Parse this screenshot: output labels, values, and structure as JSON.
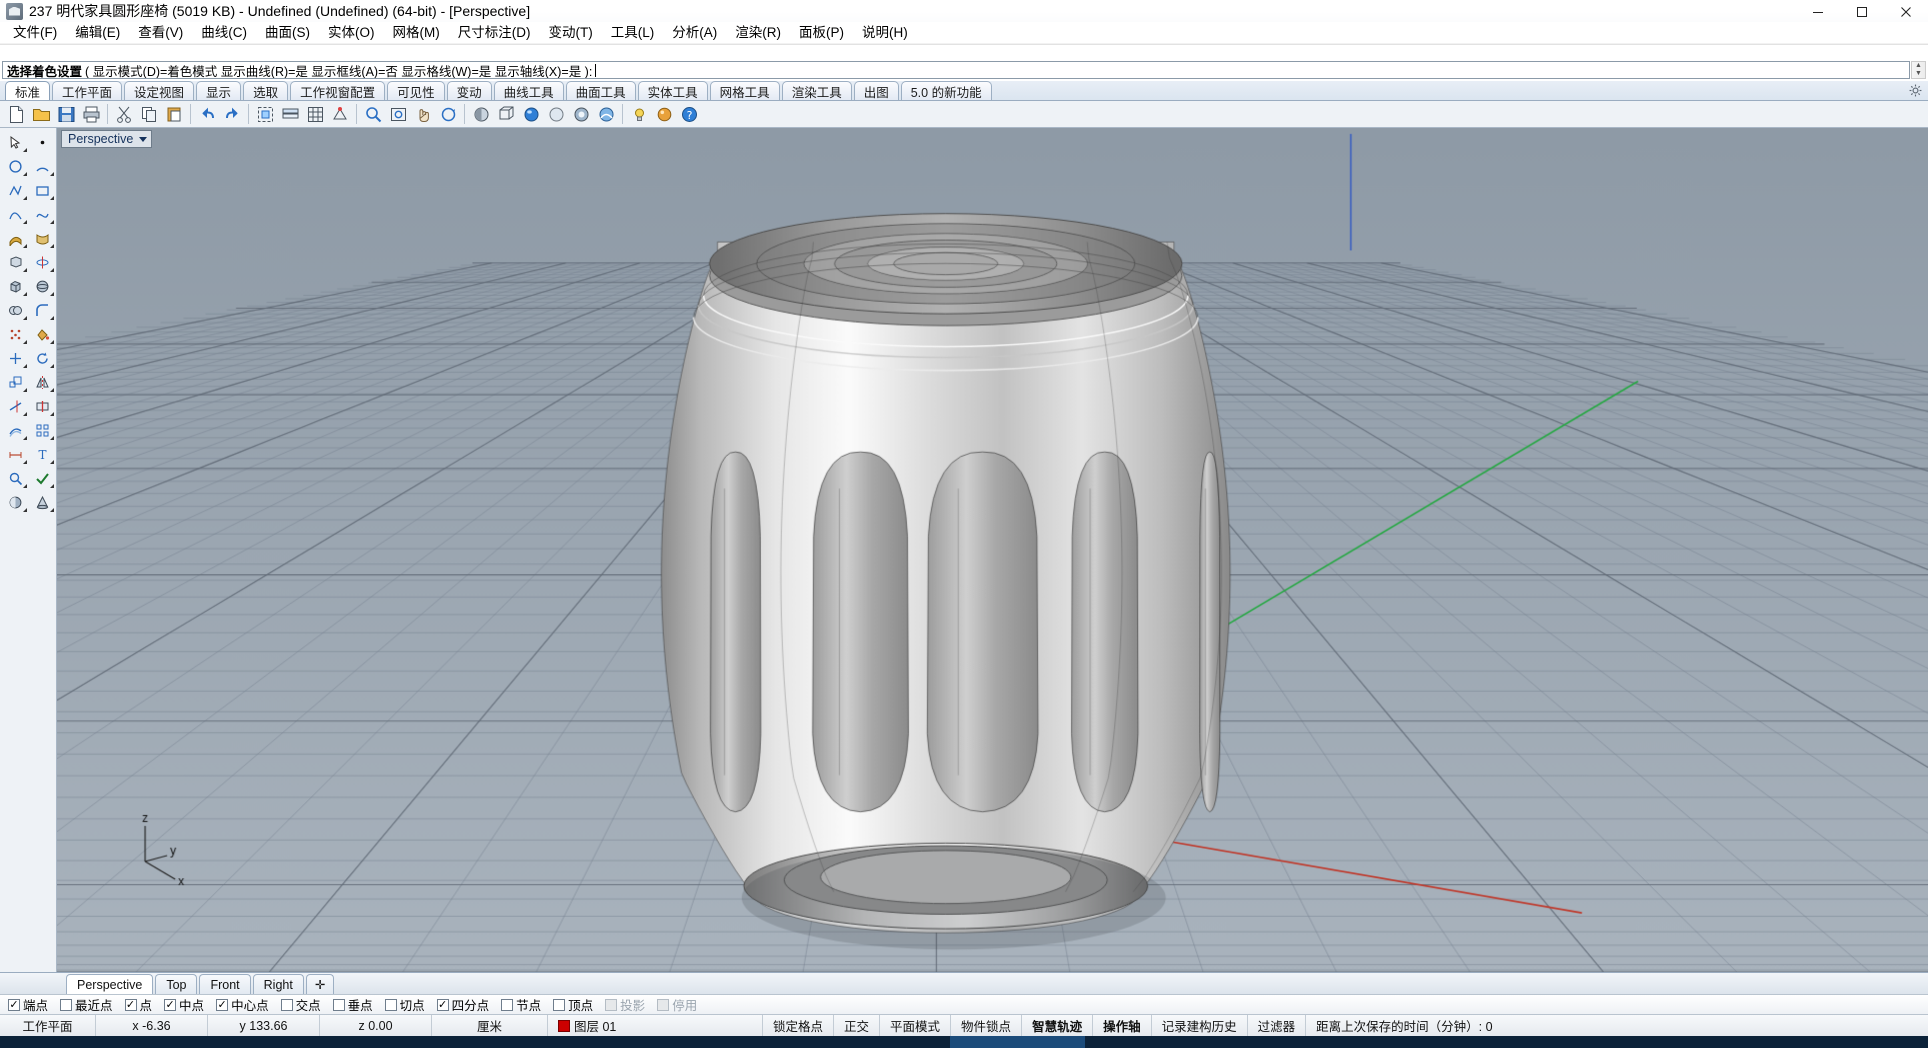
{
  "window": {
    "title": "237 明代家具圆形座椅 (5019 KB) - Undefined (Undefined) (64-bit) - [Perspective]",
    "minimize_label": "minimize",
    "maximize_label": "maximize",
    "close_label": "close"
  },
  "menubar": {
    "items": [
      {
        "label": "文件(F)"
      },
      {
        "label": "编辑(E)"
      },
      {
        "label": "查看(V)"
      },
      {
        "label": "曲线(C)"
      },
      {
        "label": "曲面(S)"
      },
      {
        "label": "实体(O)"
      },
      {
        "label": "网格(M)"
      },
      {
        "label": "尺寸标注(D)"
      },
      {
        "label": "变动(T)"
      },
      {
        "label": "工具(L)"
      },
      {
        "label": "分析(A)"
      },
      {
        "label": "渲染(R)"
      },
      {
        "label": "面板(P)"
      },
      {
        "label": "说明(H)"
      }
    ]
  },
  "command": {
    "history": "",
    "prompt": "选择着色设置",
    "options": "( 显示模式(D)=着色模式  显示曲线(R)=是  显示框线(A)=否  显示格线(W)=是  显示轴线(X)=是 ):",
    "scroll_up": "▲",
    "scroll_down": "▼"
  },
  "tabs": {
    "items": [
      {
        "label": "标准",
        "active": true
      },
      {
        "label": "工作平面",
        "active": false
      },
      {
        "label": "设定视图",
        "active": false
      },
      {
        "label": "显示",
        "active": false
      },
      {
        "label": "选取",
        "active": false
      },
      {
        "label": "工作视窗配置",
        "active": false
      },
      {
        "label": "可见性",
        "active": false
      },
      {
        "label": "变动",
        "active": false
      },
      {
        "label": "曲线工具",
        "active": false
      },
      {
        "label": "曲面工具",
        "active": false
      },
      {
        "label": "实体工具",
        "active": false
      },
      {
        "label": "网格工具",
        "active": false
      },
      {
        "label": "渲染工具",
        "active": false
      },
      {
        "label": "出图",
        "active": false
      },
      {
        "label": "5.0 的新功能",
        "active": false
      }
    ]
  },
  "viewport": {
    "label": "Perspective",
    "axis_labels": {
      "x": "x",
      "y": "y",
      "z": "z"
    },
    "background_top": "#8e9aa6",
    "background_bottom": "#a9b3bd",
    "grid_color": "#8e99a4",
    "axis_x_color": "#c0392b",
    "axis_y_color": "#27a844",
    "axis_z_color": "#2f57c4",
    "model_name": "明代家具圆形座椅 (Ming dynasty round drum stool)"
  },
  "viewport_tabs": {
    "items": [
      {
        "label": "Perspective",
        "active": true
      },
      {
        "label": "Top",
        "active": false
      },
      {
        "label": "Front",
        "active": false
      },
      {
        "label": "Right",
        "active": false
      }
    ],
    "add_label": "✛"
  },
  "osnap": {
    "items": [
      {
        "label": "端点",
        "checked": true,
        "disabled": false
      },
      {
        "label": "最近点",
        "checked": false,
        "disabled": false
      },
      {
        "label": "点",
        "checked": true,
        "disabled": false
      },
      {
        "label": "中点",
        "checked": true,
        "disabled": false
      },
      {
        "label": "中心点",
        "checked": true,
        "disabled": false
      },
      {
        "label": "交点",
        "checked": false,
        "disabled": false
      },
      {
        "label": "垂点",
        "checked": false,
        "disabled": false
      },
      {
        "label": "切点",
        "checked": false,
        "disabled": false
      },
      {
        "label": "四分点",
        "checked": true,
        "disabled": false
      },
      {
        "label": "节点",
        "checked": false,
        "disabled": false
      },
      {
        "label": "顶点",
        "checked": false,
        "disabled": false
      },
      {
        "label": "投影",
        "checked": false,
        "disabled": true
      },
      {
        "label": "停用",
        "checked": false,
        "disabled": true
      }
    ]
  },
  "statusbar": {
    "cplane": "工作平面",
    "x": "x  -6.36",
    "y": "y  133.66",
    "z": "z  0.00",
    "units": "厘米",
    "layer": "图层 01",
    "layer_color": "#cc0000",
    "toggles": [
      {
        "label": "锁定格点",
        "bold": false
      },
      {
        "label": "正交",
        "bold": false
      },
      {
        "label": "平面模式",
        "bold": false
      },
      {
        "label": "物件锁点",
        "bold": false
      },
      {
        "label": "智慧轨迹",
        "bold": true
      },
      {
        "label": "操作轴",
        "bold": true
      },
      {
        "label": "记录建构历史",
        "bold": false
      },
      {
        "label": "过滤器",
        "bold": false
      }
    ],
    "autosave": "距离上次保存的时间（分钟）: 0"
  }
}
